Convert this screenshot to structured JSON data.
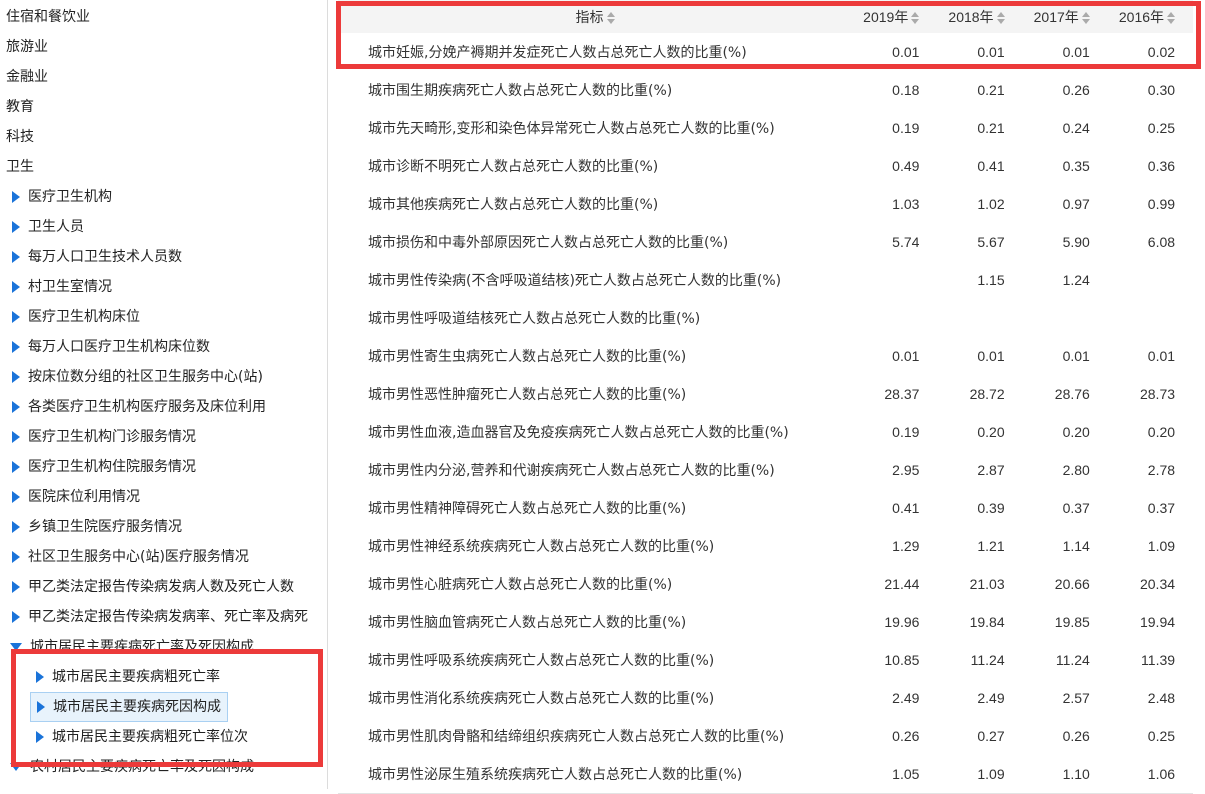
{
  "sidebar": {
    "categories": [
      "住宿和餐饮业",
      "旅游业",
      "金融业",
      "教育",
      "科技",
      "卫生"
    ],
    "health_items": [
      "医疗卫生机构",
      "卫生人员",
      "每万人口卫生技术人员数",
      "村卫生室情况",
      "医疗卫生机构床位",
      "每万人口医疗卫生机构床位数",
      "按床位数分组的社区卫生服务中心(站)",
      "各类医疗卫生机构医疗服务及床位利用",
      "医疗卫生机构门诊服务情况",
      "医疗卫生机构住院服务情况",
      "医院床位利用情况",
      "乡镇卫生院医疗服务情况",
      "社区卫生服务中心(站)医疗服务情况",
      "甲乙类法定报告传染病发病人数及死亡人数",
      "甲乙类法定报告传染病发病率、死亡率及病死"
    ],
    "expanded_item": "城市居民主要疾病死亡率及死因构成",
    "leaf_items": [
      "城市居民主要疾病粗死亡率",
      "城市居民主要疾病死因构成",
      "城市居民主要疾病粗死亡率位次"
    ],
    "active_leaf_index": 1,
    "next_item": "农村居民主要疾病死亡率及死因构成"
  },
  "table": {
    "header": {
      "indicator": "指标",
      "years": [
        "2019年",
        "2018年",
        "2017年",
        "2016年"
      ]
    },
    "rows": [
      {
        "name": "城市妊娠,分娩产褥期并发症死亡人数占总死亡人数的比重(%)",
        "values": [
          "0.01",
          "0.01",
          "0.01",
          "0.02"
        ]
      },
      {
        "name": "城市围生期疾病死亡人数占总死亡人数的比重(%)",
        "values": [
          "0.18",
          "0.21",
          "0.26",
          "0.30"
        ]
      },
      {
        "name": "城市先天畸形,变形和染色体异常死亡人数占总死亡人数的比重(%)",
        "values": [
          "0.19",
          "0.21",
          "0.24",
          "0.25"
        ]
      },
      {
        "name": "城市诊断不明死亡人数占总死亡人数的比重(%)",
        "values": [
          "0.49",
          "0.41",
          "0.35",
          "0.36"
        ]
      },
      {
        "name": "城市其他疾病死亡人数占总死亡人数的比重(%)",
        "values": [
          "1.03",
          "1.02",
          "0.97",
          "0.99"
        ]
      },
      {
        "name": "城市损伤和中毒外部原因死亡人数占总死亡人数的比重(%)",
        "values": [
          "5.74",
          "5.67",
          "5.90",
          "6.08"
        ]
      },
      {
        "name": "城市男性传染病(不含呼吸道结核)死亡人数占总死亡人数的比重(%)",
        "values": [
          "",
          "1.15",
          "1.24",
          ""
        ]
      },
      {
        "name": "城市男性呼吸道结核死亡人数占总死亡人数的比重(%)",
        "values": [
          "",
          "",
          "",
          ""
        ]
      },
      {
        "name": "城市男性寄生虫病死亡人数占总死亡人数的比重(%)",
        "values": [
          "0.01",
          "0.01",
          "0.01",
          "0.01"
        ]
      },
      {
        "name": "城市男性恶性肿瘤死亡人数占总死亡人数的比重(%)",
        "values": [
          "28.37",
          "28.72",
          "28.76",
          "28.73"
        ]
      },
      {
        "name": "城市男性血液,造血器官及免疫疾病死亡人数占总死亡人数的比重(%)",
        "values": [
          "0.19",
          "0.20",
          "0.20",
          "0.20"
        ]
      },
      {
        "name": "城市男性内分泌,营养和代谢疾病死亡人数占总死亡人数的比重(%)",
        "values": [
          "2.95",
          "2.87",
          "2.80",
          "2.78"
        ]
      },
      {
        "name": "城市男性精神障碍死亡人数占总死亡人数的比重(%)",
        "values": [
          "0.41",
          "0.39",
          "0.37",
          "0.37"
        ]
      },
      {
        "name": "城市男性神经系统疾病死亡人数占总死亡人数的比重(%)",
        "values": [
          "1.29",
          "1.21",
          "1.14",
          "1.09"
        ]
      },
      {
        "name": "城市男性心脏病死亡人数占总死亡人数的比重(%)",
        "values": [
          "21.44",
          "21.03",
          "20.66",
          "20.34"
        ]
      },
      {
        "name": "城市男性脑血管病死亡人数占总死亡人数的比重(%)",
        "values": [
          "19.96",
          "19.84",
          "19.85",
          "19.94"
        ]
      },
      {
        "name": "城市男性呼吸系统疾病死亡人数占总死亡人数的比重(%)",
        "values": [
          "10.85",
          "11.24",
          "11.24",
          "11.39"
        ]
      },
      {
        "name": "城市男性消化系统疾病死亡人数占总死亡人数的比重(%)",
        "values": [
          "2.49",
          "2.49",
          "2.57",
          "2.48"
        ]
      },
      {
        "name": "城市男性肌肉骨骼和结缔组织疾病死亡人数占总死亡人数的比重(%)",
        "values": [
          "0.26",
          "0.27",
          "0.26",
          "0.25"
        ]
      },
      {
        "name": "城市男性泌尿生殖系统疾病死亡人数占总死亡人数的比重(%)",
        "values": [
          "1.05",
          "1.09",
          "1.10",
          "1.06"
        ]
      }
    ]
  },
  "colors": {
    "highlight_box": "#ec3a3a",
    "tree_arrow": "#1a73d9",
    "active_bg": "#e8f3fc"
  }
}
